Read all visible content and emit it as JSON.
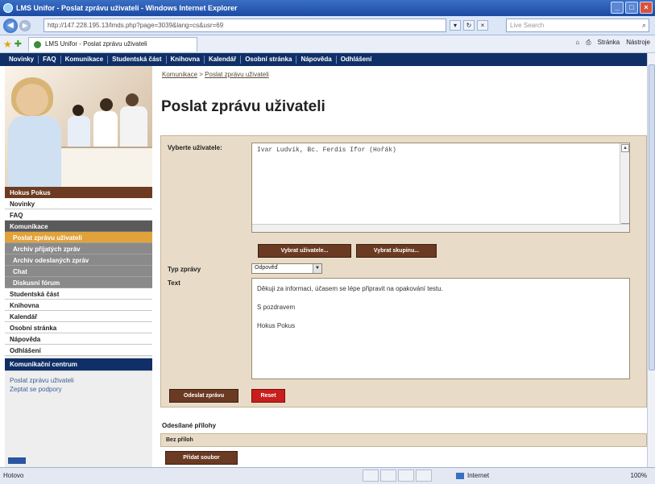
{
  "browser": {
    "title": "LMS Unifor - Poslat zprávu uživateli - Windows Internet Explorer",
    "url": "http://147.228.195.13/lmds.php?page=3039&lang=cs&usr=69",
    "search_placeholder": "Live Search",
    "tab_label": "LMS Unifor - Poslat zprávu uživateli",
    "tools": [
      "Stránka",
      "Nástroje"
    ],
    "status_left": "Hotovo",
    "status_zone": "Internet",
    "zoom": "100%"
  },
  "nav": [
    "Novinky",
    "FAQ",
    "Komunikace",
    "Studentská část",
    "Knihovna",
    "Kalendář",
    "Osobní stránka",
    "Nápověda",
    "Odhlášení"
  ],
  "sidebar": {
    "user": "Hokus Pokus",
    "menu": [
      {
        "label": "Novinky",
        "kind": "plain"
      },
      {
        "label": "FAQ",
        "kind": "plain"
      },
      {
        "label": "Komunikace",
        "kind": "dark"
      },
      {
        "label": "Poslat zprávu uživateli",
        "kind": "active"
      },
      {
        "label": "Archiv přijatých zpráv",
        "kind": "sub"
      },
      {
        "label": "Archiv odeslaných zpráv",
        "kind": "sub"
      },
      {
        "label": "Chat",
        "kind": "sub"
      },
      {
        "label": "Diskusní fórum",
        "kind": "sub"
      },
      {
        "label": "Studentská část",
        "kind": "plain"
      },
      {
        "label": "Knihovna",
        "kind": "plain"
      },
      {
        "label": "Kalendář",
        "kind": "plain"
      },
      {
        "label": "Osobní stránka",
        "kind": "plain"
      },
      {
        "label": "Nápověda",
        "kind": "plain"
      },
      {
        "label": "Odhlášení",
        "kind": "plain"
      }
    ],
    "section_title": "Komunikační centrum",
    "section_links": [
      "Poslat zprávu uživateli",
      "Zeptat se podpory"
    ]
  },
  "main": {
    "breadcrumb": [
      "Komunikace",
      "Poslat zprávu uživateli"
    ],
    "breadcrumb_sep": " > ",
    "title": "Poslat zprávu uživateli",
    "recipients_label": "Vyberte uživatele:",
    "recipients_value": "Ivar Ludvík, Bc. Ferdis Ifor (Hořák)",
    "btn_select_users": "Vybrat uživatele...",
    "btn_select_group": "Vybrat skupinu...",
    "type_label": "Typ zprávy",
    "type_value": "Odpověď",
    "text_label": "Text",
    "message_lines": [
      "Děkuji za informaci, účasem se lépe připravit na opakování testu.",
      "S pozdravem",
      "Hokus Pokus"
    ],
    "btn_send": "Odeslat zprávu",
    "btn_reset": "Reset",
    "attachments_title": "Odesílané přílohy",
    "attachments_empty": "Bez příloh",
    "btn_add_attachment": "Přidat soubor"
  }
}
